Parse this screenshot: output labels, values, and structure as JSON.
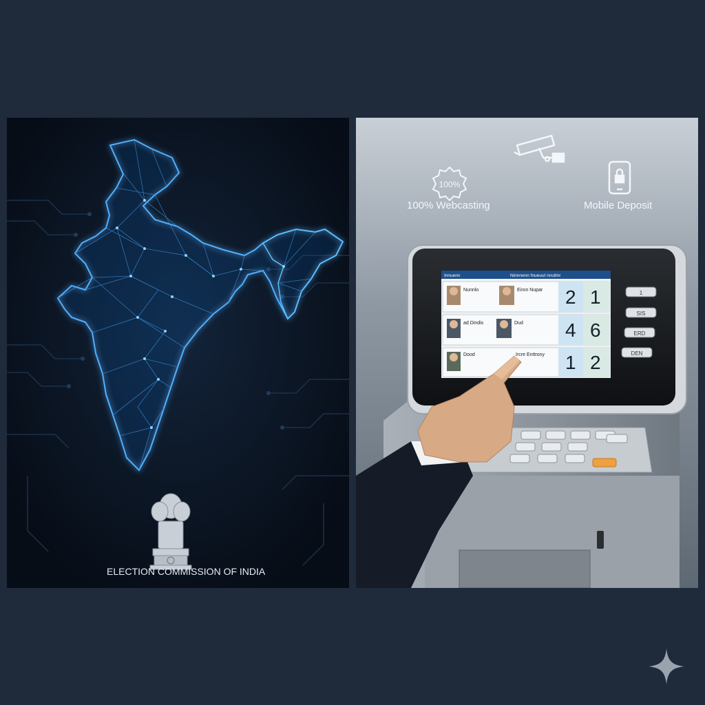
{
  "left_panel": {
    "caption": "ELECTION COMMISSION OF INDIA",
    "map_icon": "india-network-map",
    "emblem_icon": "lion-capital-emblem"
  },
  "right_panel": {
    "features": [
      {
        "icon": "badge-100-icon",
        "badge_text": "100%",
        "label": "100% Webcasting"
      },
      {
        "icon": "cctv-camera-icon",
        "label": ""
      },
      {
        "icon": "mobile-lock-icon",
        "label": "Mobile Deposit"
      }
    ],
    "screen": {
      "header_left": "Innuenn",
      "header_right": "Ninnnenn fnueuut nnuttnr",
      "rows": [
        {
          "name_a": "Nunnlo",
          "name_b": "Eiron Nupar",
          "digits": [
            "2",
            "1"
          ]
        },
        {
          "name_a": "ad Dindis",
          "name_b": "Dud",
          "digits": [
            "4",
            "6"
          ]
        },
        {
          "name_a": "Dood",
          "name_b": "Ircre Enttrony",
          "digits": [
            "1",
            "2"
          ]
        }
      ]
    },
    "side_buttons": [
      "1",
      "SIS",
      "ERD",
      "DEN"
    ]
  },
  "corner_icon": "sparkle-icon",
  "colors": {
    "background": "#1f2a3b",
    "map_glow": "#3aa0ff",
    "keypad_accent": "#f0a040"
  }
}
